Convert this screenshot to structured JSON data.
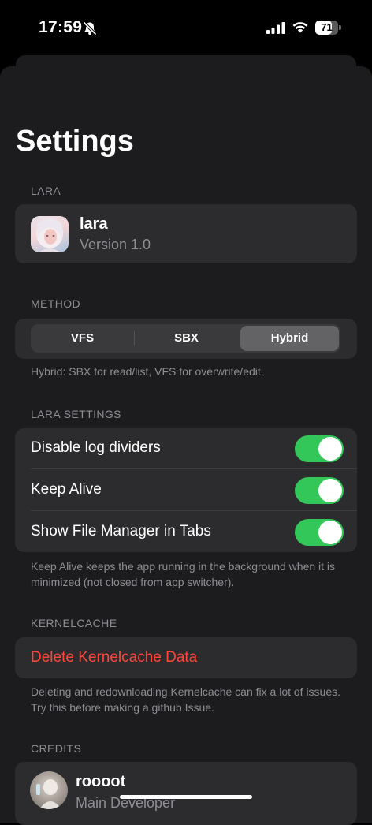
{
  "status_bar": {
    "time": "17:59",
    "battery": "71",
    "battery_level": 71,
    "icons": [
      "bell-slash-icon",
      "signal-icon",
      "wifi-icon",
      "battery-icon"
    ]
  },
  "page": {
    "title": "Settings"
  },
  "sections": {
    "lara": {
      "header": "LARA",
      "app_name": "lara",
      "version": "Version 1.0"
    },
    "method": {
      "header": "METHOD",
      "options": [
        "VFS",
        "SBX",
        "Hybrid"
      ],
      "selected": "Hybrid",
      "footer": "Hybrid: SBX for read/list, VFS for overwrite/edit."
    },
    "lara_settings": {
      "header": "LARA SETTINGS",
      "toggles": [
        {
          "label": "Disable log dividers",
          "on": true
        },
        {
          "label": "Keep Alive",
          "on": true
        },
        {
          "label": "Show File Manager in Tabs",
          "on": true
        }
      ],
      "footer": "Keep Alive keeps the app running in the background when it is minimized (not closed from app switcher)."
    },
    "kernelcache": {
      "header": "KERNELCACHE",
      "action": "Delete Kernelcache Data",
      "footer": "Deleting and redownloading Kernelcache can fix a lot of issues. Try this before making a github Issue."
    },
    "credits": {
      "header": "CREDITS",
      "items": [
        {
          "name": "roooot",
          "role": "Main Developer"
        }
      ]
    }
  },
  "colors": {
    "accent_green": "#33c759",
    "destructive_red": "#ff453a",
    "card_bg": "#2c2c2e",
    "sheet_bg": "#1c1c1e",
    "secondary_text": "#8d8d93"
  }
}
